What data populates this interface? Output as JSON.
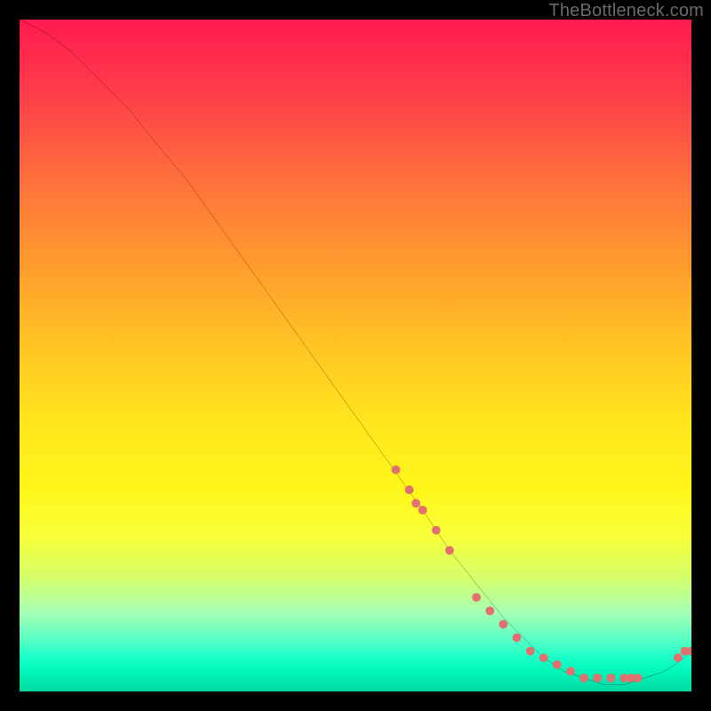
{
  "watermark": "TheBottleneck.com",
  "chart_data": {
    "type": "line",
    "title": "",
    "xlabel": "",
    "ylabel": "",
    "xlim": [
      0,
      100
    ],
    "ylim": [
      0,
      100
    ],
    "x": [
      0,
      4,
      8,
      12,
      16,
      20,
      25,
      30,
      35,
      40,
      45,
      50,
      55,
      60,
      64,
      68,
      72,
      75,
      78,
      81,
      84,
      87,
      90,
      93,
      96,
      99,
      100
    ],
    "values": [
      100,
      98,
      95,
      91,
      87,
      82,
      76,
      69,
      62,
      55,
      48,
      41,
      34,
      27,
      21,
      16,
      11,
      8,
      5,
      3,
      2,
      1,
      1,
      2,
      3,
      5,
      6
    ],
    "series_dots": {
      "name": "markers",
      "x": [
        56,
        58,
        59,
        60,
        62,
        64,
        68,
        70,
        72,
        74,
        76,
        78,
        80,
        82,
        84,
        86,
        88,
        90,
        91,
        92,
        98,
        99,
        100
      ],
      "values": [
        33,
        30,
        28,
        27,
        24,
        21,
        14,
        12,
        10,
        8,
        6,
        5,
        4,
        3,
        2,
        2,
        2,
        2,
        2,
        2,
        5,
        6,
        6
      ]
    },
    "colors": {
      "curve": "#000000",
      "dots": "#e37070",
      "bg_top": "#ff1a4f",
      "bg_bottom": "#00d8a0"
    }
  }
}
